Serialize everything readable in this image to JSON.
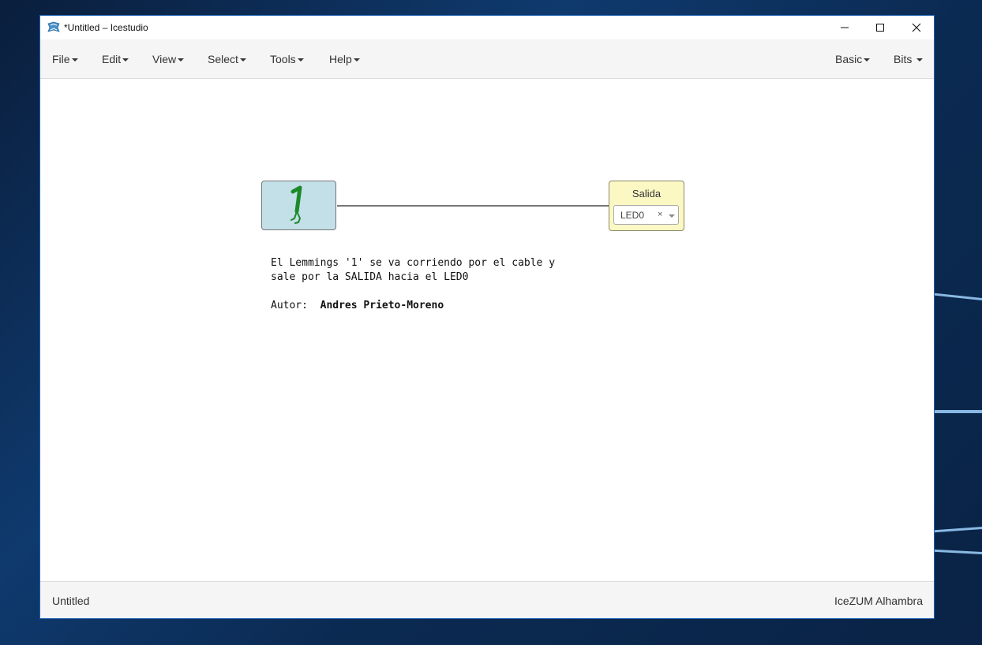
{
  "window": {
    "title": "*Untitled – Icestudio",
    "controls": [
      "minimize",
      "maximize",
      "close"
    ]
  },
  "menu": {
    "left": [
      {
        "label": "File"
      },
      {
        "label": "Edit"
      },
      {
        "label": "View"
      },
      {
        "label": "Select"
      },
      {
        "label": "Tools"
      },
      {
        "label": "Help"
      }
    ],
    "right": [
      {
        "label": "Basic"
      },
      {
        "label": "Bits"
      }
    ]
  },
  "canvas": {
    "constant_block": {
      "value": "1",
      "icon": "lemming-one-icon",
      "color": "#c3dfe8"
    },
    "output_block": {
      "label": "Salida",
      "pin": "LED0",
      "clear": "×",
      "color": "#fbf8c4"
    },
    "note": {
      "line1": "El Lemmings '1' se va corriendo por el cable y",
      "line2": "sale por la SALIDA hacia el LED0",
      "author_label": "Autor:",
      "author_name": "Andres Prieto-Moreno"
    }
  },
  "footer": {
    "left": "Untitled",
    "right": "IceZUM Alhambra"
  },
  "colors": {
    "accent": "#1f63b5",
    "lemming": "#1d8a2a"
  }
}
